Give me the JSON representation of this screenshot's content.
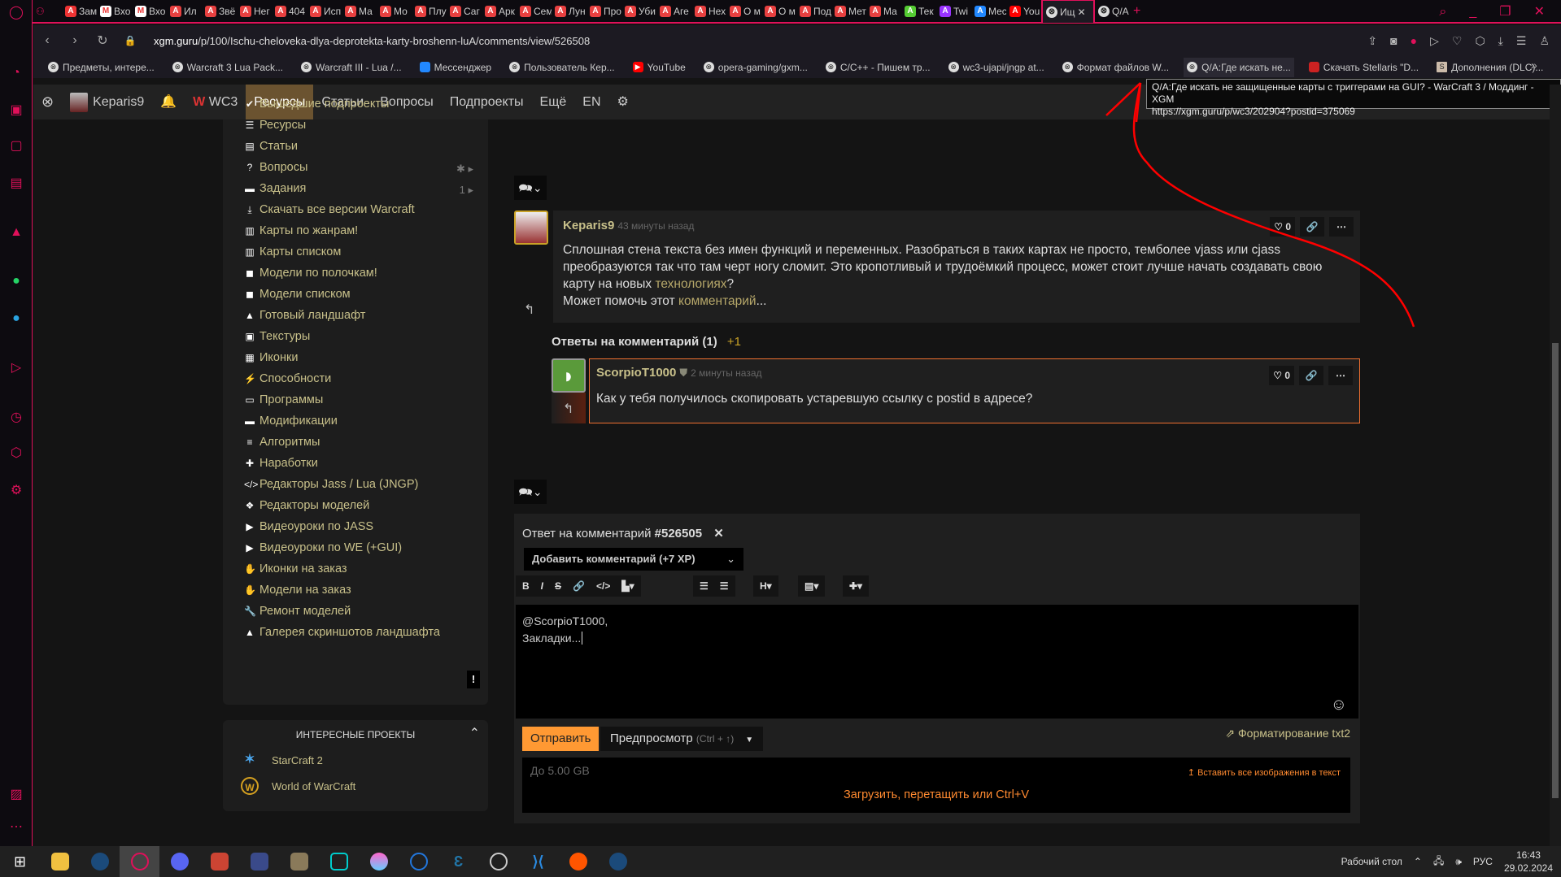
{
  "browser": {
    "tabs": [
      "Зам",
      "Вхо",
      "Вхо",
      "Ил",
      "Звё",
      "Нег",
      "404",
      "Исп",
      "Ма",
      "Мо",
      "Плу",
      "Саг",
      "Арк",
      "Сем",
      "Лун",
      "Про",
      "Уби",
      "Аге",
      "Нех",
      "О м",
      "О м",
      "Под",
      "Мет",
      "Ма",
      "Тек",
      "Twi",
      "Мес",
      "You",
      "Ищ",
      "Q/A"
    ],
    "url_domain": "xgm.guru",
    "url_path": "/p/100/Ischu-cheloveka-dlya-deprotekta-karty-broshenn-luA/comments/view/526508",
    "bookmarks": [
      "Предметы, интере...",
      "Warcraft 3 Lua Pack...",
      "Warcraft III - Lua /...",
      "Мессенджер",
      "Пользователь Кер...",
      "YouTube",
      "opera-gaming/gxm...",
      "C/C++ - Пишем тр...",
      "wc3-ujapi/jngp at...",
      "Формат файлов W...",
      "Q/A:Где искать не...",
      "Скачать Stellaris \"D...",
      "Дополнения (DLC)..."
    ],
    "tooltip_title": "Q/A:Где искать не защищенные карты с триггерами на GUI? - WarCraft 3 / Моддинг - XGM",
    "tooltip_url": "https://xgm.guru/p/wc3/202904?postid=375069"
  },
  "sitenav": {
    "user": "Keparis9",
    "project": "WC3",
    "items": [
      "Ресурсы",
      "Статьи",
      "Вопросы",
      "Подпроекты",
      "Ещё",
      "EN"
    ]
  },
  "sidebar": {
    "items": [
      {
        "label": "Вышедшие подпроекты",
        "icon": "✔"
      },
      {
        "label": "Ресурсы",
        "icon": "☰"
      },
      {
        "label": "Статьи",
        "icon": "▤"
      },
      {
        "label": "Вопросы",
        "icon": "?",
        "count": "✱"
      },
      {
        "label": "Задания",
        "icon": "▬",
        "count": "1"
      },
      {
        "label": "Скачать все версии Warcraft",
        "icon": "⤓"
      },
      {
        "label": "Карты по жанрам!",
        "icon": "▥"
      },
      {
        "label": "Карты списком",
        "icon": "▥"
      },
      {
        "label": "Модели по полочкам!",
        "icon": "◼"
      },
      {
        "label": "Модели списком",
        "icon": "◼"
      },
      {
        "label": "Готовый ландшафт",
        "icon": "▲"
      },
      {
        "label": "Текстуры",
        "icon": "▣"
      },
      {
        "label": "Иконки",
        "icon": "▦"
      },
      {
        "label": "Способности",
        "icon": "⚡"
      },
      {
        "label": "Программы",
        "icon": "▭"
      },
      {
        "label": "Модификации",
        "icon": "▬"
      },
      {
        "label": "Алгоритмы",
        "icon": "≡"
      },
      {
        "label": "Наработки",
        "icon": "✚"
      },
      {
        "label": "Редакторы Jass / Lua (JNGP)",
        "icon": "</>"
      },
      {
        "label": "Редакторы моделей",
        "icon": "❖"
      },
      {
        "label": "Видеоуроки по JASS",
        "icon": "▶"
      },
      {
        "label": "Видеоуроки по WE (+GUI)",
        "icon": "▶"
      },
      {
        "label": "Иконки на заказ",
        "icon": "✋"
      },
      {
        "label": "Модели на заказ",
        "icon": "✋"
      },
      {
        "label": "Ремонт моделей",
        "icon": "🔧"
      },
      {
        "label": "Галерея скриншотов ландшафта",
        "icon": "▲"
      }
    ],
    "alert": "!",
    "projects_title": "ИНТЕРЕСНЫЕ ПРОЕКТЫ",
    "projects": [
      "StarCraft 2",
      "World of WarCraft"
    ]
  },
  "comment": {
    "author": "Keparis9",
    "time": "43 минуты назад",
    "likes": "0",
    "text1": "Сплошная стена текста без имен функций и переменных. Разобраться в таких картах не просто, темболее vjass или cjass преобразуются так что там черт ногу сломит. Это кропотливый и трудоёмкий процесс, может стоит лучше начать создавать свою карту на новых ",
    "link1": "технологиях",
    "text2": "?",
    "text3": "Может помочь этот ",
    "link2": "комментарий",
    "text4": "..."
  },
  "replies": {
    "title": "Ответы на комментарий (1)",
    "plus": "+1"
  },
  "reply": {
    "author": "ScorpioT1000",
    "time": "2 минуты назад",
    "likes": "0",
    "text": "Как у тебя получилось скопировать устаревшую ссылку с postid в адресе?"
  },
  "editor": {
    "title": "Ответ на комментарий",
    "id": "#526505",
    "type": "Добавить комментарий (+7 XP)",
    "line1": "@ScorpioT1000,",
    "line2": "Закладки...",
    "send": "Отправить",
    "preview": "Предпросмотр",
    "preview_hint": "(Ctrl + ↑)",
    "format": "Форматирование txt2",
    "limit": "До 5.00 GB",
    "insert_all": "Вставить все изображения в текст",
    "upload": "Загрузить, перетащить или Ctrl+V"
  },
  "taskbar": {
    "desktop": "Рабочий стол",
    "lang": "РУС",
    "time": "16:43",
    "date": "29.02.2024"
  },
  "colors": {
    "accent": "#e0105a",
    "orange": "#ff9933",
    "link": "#c8c08a"
  }
}
